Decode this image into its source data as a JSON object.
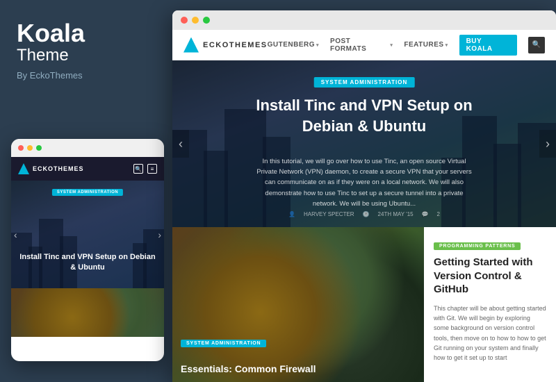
{
  "brand": {
    "title": "Koala",
    "subtitle": "Theme",
    "by": "By EckoThemes"
  },
  "nav": {
    "logo_text": "ECKOTHEMES",
    "links": [
      "GUTENBERG ▾",
      "POST FORMATS ▾",
      "FEATURES ▾",
      "BUY KOALA"
    ],
    "search_icon": "🔍"
  },
  "hero": {
    "badge": "SYSTEM ADMINISTRATION",
    "title": "Install Tinc and VPN Setup on Debian & Ubuntu",
    "description": "In this tutorial, we will go over how to use Tinc, an open source Virtual Private Network (VPN) daemon, to create a secure VPN that your servers can communicate on as if they were on a local network. We will also demonstrate how to use Tinc to set up a secure tunnel into a private network. We will be using Ubuntu...",
    "author": "HARVEY SPECTER",
    "date": "24TH MAY '15",
    "comments": "2"
  },
  "bottom_left": {
    "badge": "SYSTEM ADMINISTRATION",
    "title": "Essentials: Common Firewall"
  },
  "bottom_right": {
    "badge": "PROGRAMMING PATTERNS",
    "title": "Getting Started with Version Control & GitHub",
    "description": "This chapter will be about getting started with Git. We will begin by exploring some background on version control tools, then move on to how to how to get Git running on your system and finally how to get it set up to start"
  },
  "mobile": {
    "badge": "SYSTEM ADMINISTRATION",
    "title": "Install Tinc and VPN Setup on Debian & Ubuntu"
  }
}
